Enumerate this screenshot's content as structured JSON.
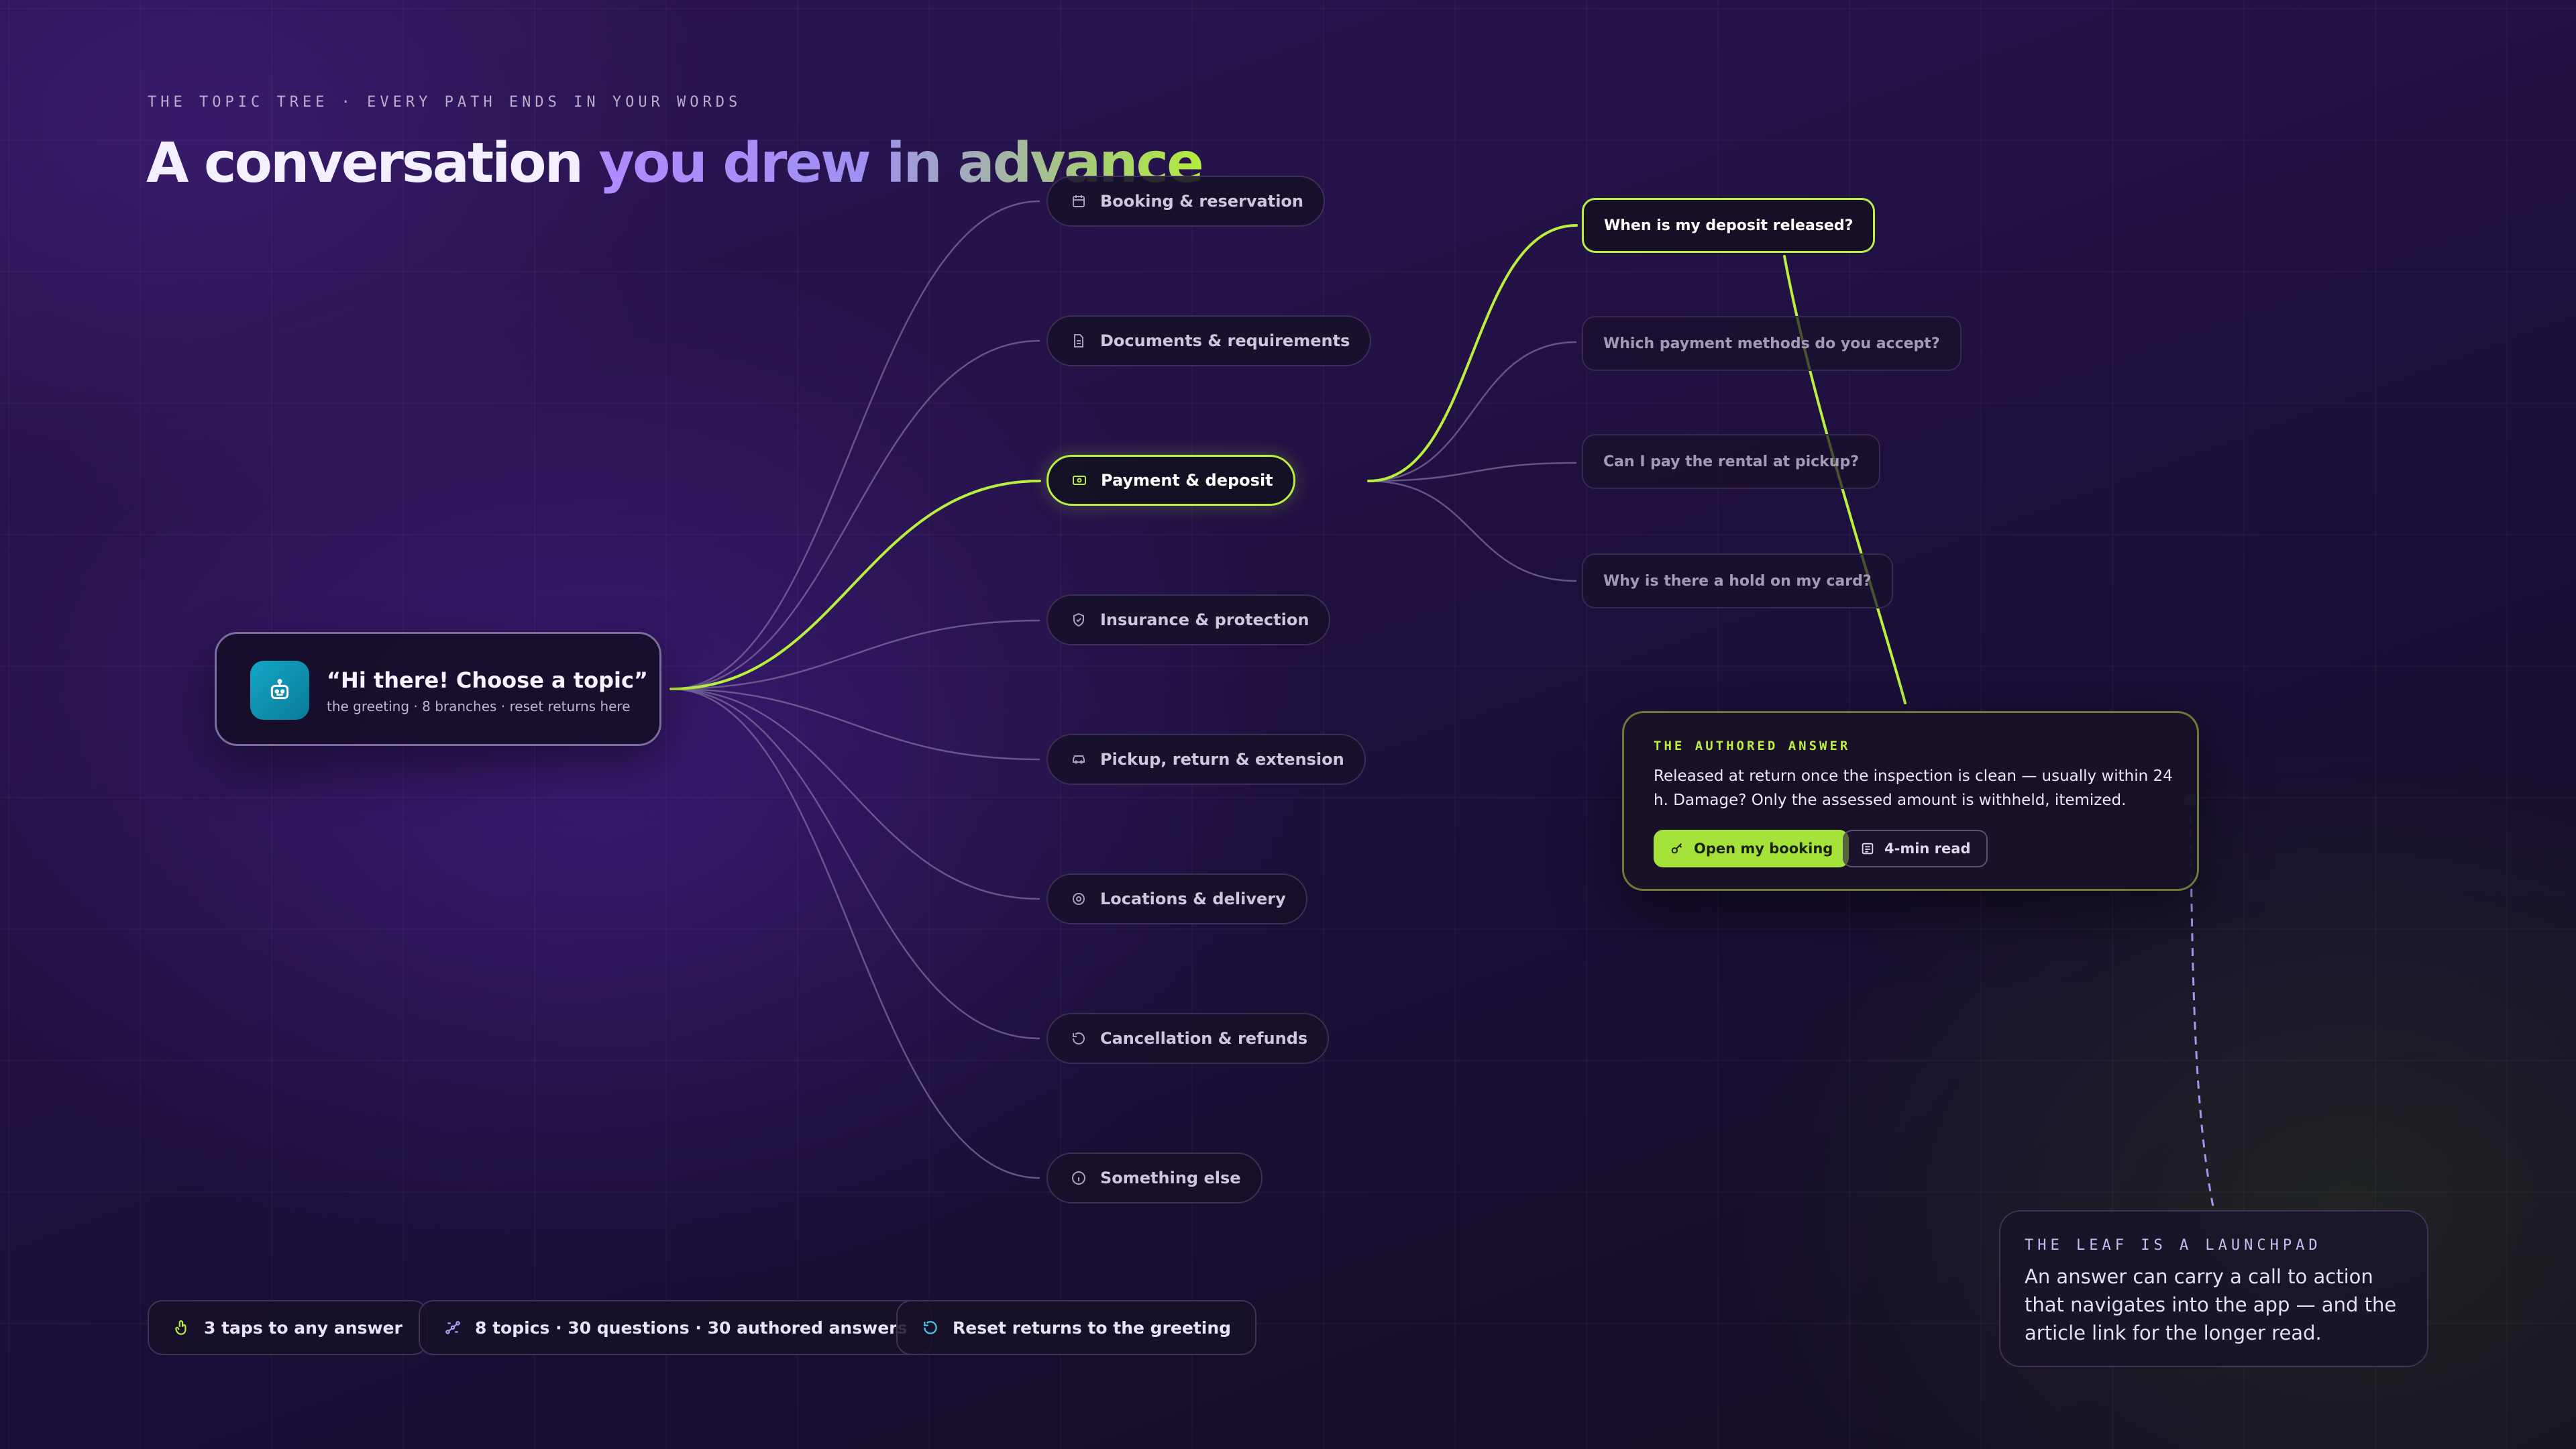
{
  "eyebrow": "THE TOPIC TREE · EVERY PATH ENDS IN YOUR WORDS",
  "headline": {
    "part1": "A conversation ",
    "part2": "you drew in advance"
  },
  "root": {
    "title": "“Hi there! Choose a topic”",
    "subtitle": "the greeting · 8 branches · reset returns here",
    "icon": "robot-icon"
  },
  "topics": [
    {
      "label": "Booking & reservation",
      "icon": "calendar-icon"
    },
    {
      "label": "Documents & requirements",
      "icon": "document-icon"
    },
    {
      "label": "Payment & deposit",
      "icon": "cash-icon",
      "active": true
    },
    {
      "label": "Insurance & protection",
      "icon": "shield-icon"
    },
    {
      "label": "Pickup, return & extension",
      "icon": "car-icon"
    },
    {
      "label": "Locations & delivery",
      "icon": "location-icon"
    },
    {
      "label": "Cancellation & refunds",
      "icon": "refresh-icon"
    },
    {
      "label": "Something else",
      "icon": "info-icon"
    }
  ],
  "questions": [
    {
      "label": "When is my deposit released?",
      "active": true
    },
    {
      "label": "Which payment methods do you accept?"
    },
    {
      "label": "Can I pay the rental at pickup?"
    },
    {
      "label": "Why is there a hold on my card?"
    }
  ],
  "answer": {
    "label": "THE AUTHORED ANSWER",
    "body": "Released at return once the inspection is clean — usually within 24 h. Damage? Only the assessed amount is withheld, itemized.",
    "primary_button": "Open my booking",
    "secondary_button": "4-min read"
  },
  "note": {
    "label": "THE LEAF IS A LAUNCHPAD",
    "body": "An answer can carry a call to action that navigates into the app — and the article link for the longer read."
  },
  "stats": [
    {
      "label": "3 taps to any answer",
      "icon": "tap-icon"
    },
    {
      "label": "8 topics · 30 questions · 30 authored answers",
      "icon": "tree-icon"
    },
    {
      "label": "Reset returns to the greeting",
      "icon": "reset-icon"
    }
  ],
  "colors": {
    "accent": "#b9f03e",
    "violet": "#9d7bff",
    "teal": "#14a6c6"
  }
}
